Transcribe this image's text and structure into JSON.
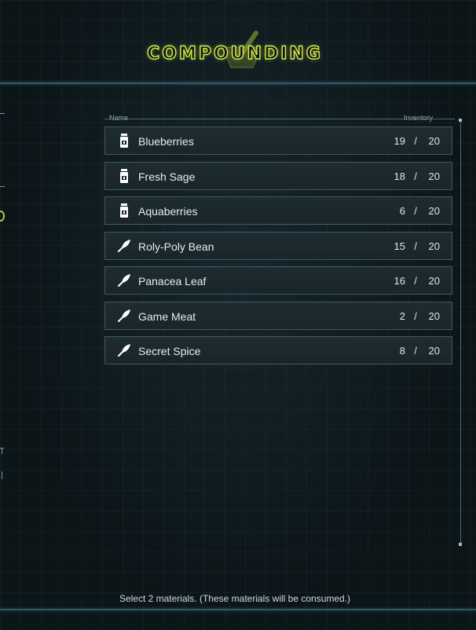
{
  "screen": {
    "title": "COMPOUNDING",
    "accent_color": "#d7e94a",
    "panel_border_color": "#3e5a62"
  },
  "list": {
    "columns": {
      "name": "Name",
      "inventory": "Inventory"
    },
    "items": [
      {
        "name": "Blueberries",
        "icon": "vial-icon",
        "have": "19",
        "slash": "/",
        "max": "20"
      },
      {
        "name": "Fresh Sage",
        "icon": "vial-icon",
        "have": "18",
        "slash": "/",
        "max": "20"
      },
      {
        "name": "Aquaberries",
        "icon": "vial-icon",
        "have": "6",
        "slash": "/",
        "max": "20"
      },
      {
        "name": "Roly-Poly Bean",
        "icon": "leaf-icon",
        "have": "15",
        "slash": "/",
        "max": "20"
      },
      {
        "name": "Panacea Leaf",
        "icon": "leaf-icon",
        "have": "16",
        "slash": "/",
        "max": "20"
      },
      {
        "name": "Game Meat",
        "icon": "leaf-icon",
        "have": "2",
        "slash": "/",
        "max": "20"
      },
      {
        "name": "Secret Spice",
        "icon": "leaf-icon",
        "have": "8",
        "slash": "/",
        "max": "20"
      }
    ]
  },
  "footer": {
    "instruction": "Select 2 materials. (These materials will be consumed.)"
  }
}
